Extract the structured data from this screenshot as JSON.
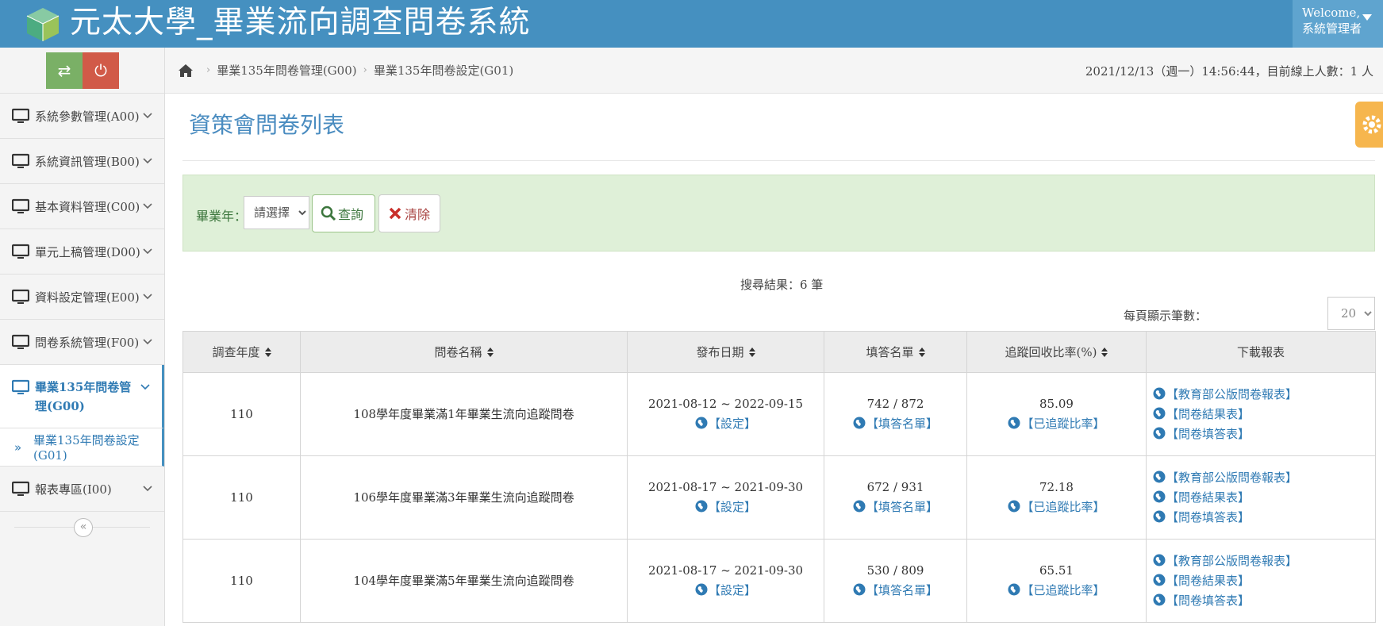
{
  "header": {
    "title": "元太大學_畢業流向調查問卷系統",
    "logo_icon": "cube-logo-icon",
    "welcome": "Welcome,",
    "user": "系統管理者"
  },
  "sidebar": {
    "tools": [
      {
        "name": "switch-icon",
        "glyph": "⇄"
      },
      {
        "name": "power-icon",
        "glyph": "⏻"
      }
    ],
    "items": [
      {
        "label": "系統參數管理(A00)"
      },
      {
        "label": "系統資訊管理(B00)"
      },
      {
        "label": "基本資料管理(C00)"
      },
      {
        "label": "單元上稿管理(D00)"
      },
      {
        "label": "資料設定管理(E00)"
      },
      {
        "label": "問卷系統管理(F00)"
      },
      {
        "label": "畢業135年問卷管理(G00)"
      },
      {
        "label": "報表專區(I00)"
      }
    ],
    "submenu": {
      "label": "畢業135年問卷設定(G01)"
    },
    "collapse_glyph": "«"
  },
  "breadcrumb": {
    "items": [
      "畢業135年問卷管理(G00)",
      "畢業135年問卷設定(G01)"
    ],
    "clock": "2021/12/13（週一）14:56:44，目前線上人數：1 人"
  },
  "page": {
    "title": "資策會問卷列表"
  },
  "filter": {
    "year_label": "畢業年：",
    "year_selected": "請選擇",
    "search_label": "查詢",
    "clear_label": "清除"
  },
  "results": {
    "count_text": "搜尋結果：6 筆",
    "perpage_label": "每頁顯示筆數：",
    "perpage_value": "20"
  },
  "table": {
    "headers": [
      "調查年度",
      "問卷名稱",
      "發布日期",
      "填答名單",
      "追蹤回收比率(%)",
      "下載報表"
    ],
    "rows": [
      {
        "year": "110",
        "name": "108學年度畢業滿1年畢業生流向追蹤問卷",
        "dates": "2021-08-12 ~ 2022-09-15",
        "setting": "【設定】",
        "count": "742 / 872",
        "list_link": "【填答名單】",
        "rate": "85.09",
        "rate_link": "【已追蹤比率】",
        "reports": [
          "【教育部公版問卷報表】",
          "【問卷結果表】",
          "【問卷填答表】"
        ]
      },
      {
        "year": "110",
        "name": "106學年度畢業滿3年畢業生流向追蹤問卷",
        "dates": "2021-08-17 ~ 2021-09-30",
        "setting": "【設定】",
        "count": "672 / 931",
        "list_link": "【填答名單】",
        "rate": "72.18",
        "rate_link": "【已追蹤比率】",
        "reports": [
          "【教育部公版問卷報表】",
          "【問卷結果表】",
          "【問卷填答表】"
        ]
      },
      {
        "year": "110",
        "name": "104學年度畢業滿5年畢業生流向追蹤問卷",
        "dates": "2021-08-17 ~ 2021-09-30",
        "setting": "【設定】",
        "count": "530 / 809",
        "list_link": "【填答名單】",
        "rate": "65.51",
        "rate_link": "【已追蹤比率】",
        "reports": [
          "【教育部公版問卷報表】",
          "【問卷結果表】",
          "【問卷填答表】"
        ]
      }
    ]
  },
  "colors": {
    "header": "#4590c0",
    "accent": "#2f7ab3",
    "filter_bg": "#dff0d8",
    "settings_tab": "#f6b64e"
  }
}
